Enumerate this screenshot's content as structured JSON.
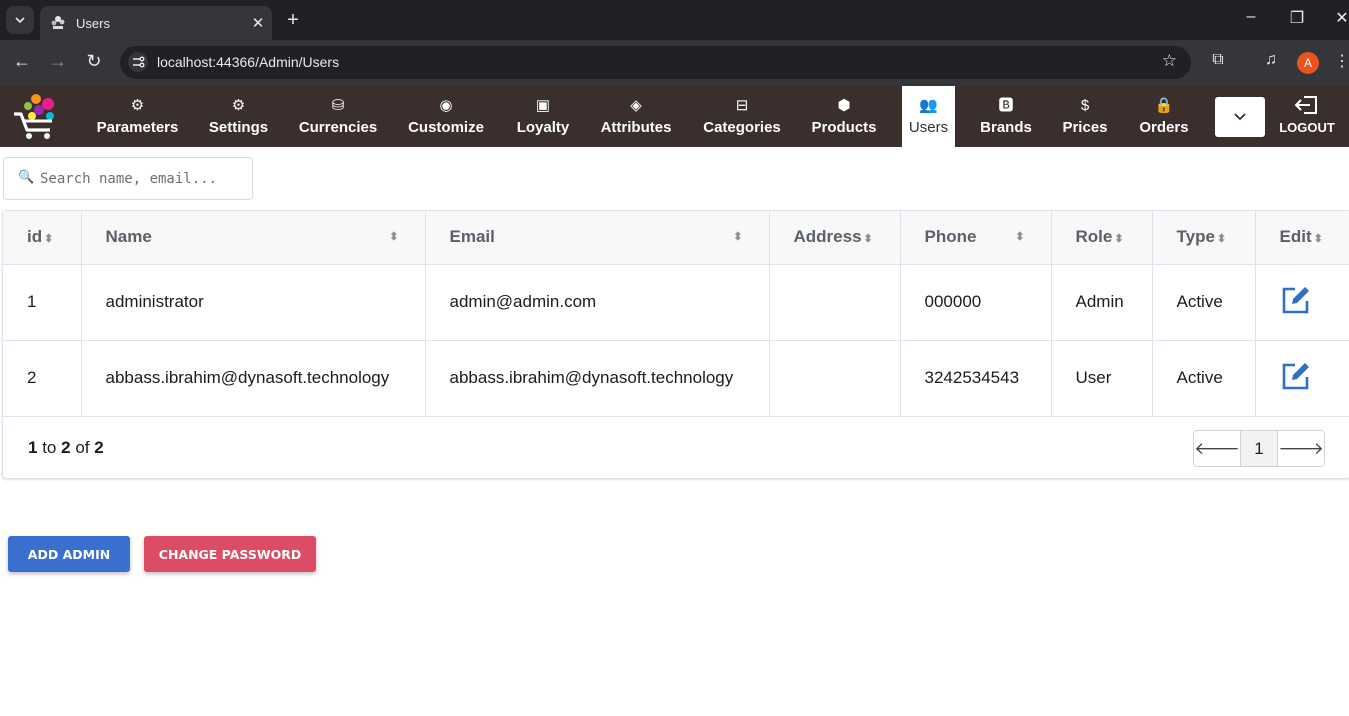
{
  "browser": {
    "tab_title": "Users",
    "url": "localhost:44366/Admin/Users",
    "profile_initial": "A",
    "new_tab_icon": "+",
    "close_icon": "✕"
  },
  "nav": {
    "items": [
      {
        "label": "Parameters",
        "icon": "gear-outline-icon"
      },
      {
        "label": "Settings",
        "icon": "gear-icon"
      },
      {
        "label": "Currencies",
        "icon": "coins-icon"
      },
      {
        "label": "Customize",
        "icon": "edge-icon"
      },
      {
        "label": "Loyalty",
        "icon": "card-icon"
      },
      {
        "label": "Attributes",
        "icon": "diamond-grid-icon"
      },
      {
        "label": "Categories",
        "icon": "stack-icon"
      },
      {
        "label": "Products",
        "icon": "box-icon"
      },
      {
        "label": "Users",
        "icon": "users-icon"
      },
      {
        "label": "Brands",
        "icon": "brand-b-icon"
      },
      {
        "label": "Prices",
        "icon": "dollar-circle-icon"
      },
      {
        "label": "Orders",
        "icon": "bag-icon"
      }
    ],
    "active": "Users",
    "logout_label": "LOGOUT"
  },
  "search": {
    "placeholder": "Search name, email..."
  },
  "table": {
    "columns": [
      "id",
      "Name",
      "Email",
      "Address",
      "Phone",
      "Role",
      "Type",
      "Edit"
    ],
    "rows": [
      {
        "id": "1",
        "name": "administrator",
        "email": "admin@admin.com",
        "address": "",
        "phone": "000000",
        "role": "Admin",
        "type": "Active"
      },
      {
        "id": "2",
        "name": "abbass.ibrahim@dynasoft.technology",
        "email": "abbass.ibrahim@dynasoft.technology",
        "address": "",
        "phone": "3242534543",
        "role": "User",
        "type": "Active"
      }
    ],
    "pager": {
      "from": "1",
      "to_word": "to",
      "to": "2",
      "of_word": "of",
      "total": "2",
      "current_page": "1"
    }
  },
  "actions": {
    "add_admin": "ADD ADMIN",
    "change_password": "CHANGE PASSWORD"
  },
  "colors": {
    "nav_bg": "#3b2f2e",
    "add_btn": "#3a6fcf",
    "pass_btn": "#dc4c64",
    "edit_icon": "#2f6fc4"
  }
}
